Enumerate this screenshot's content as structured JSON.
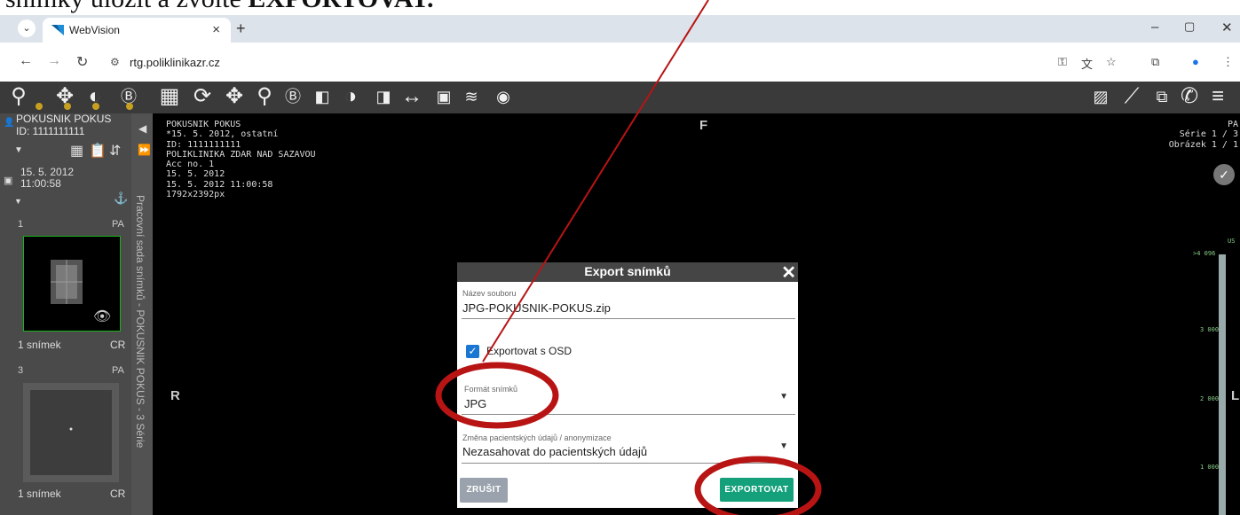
{
  "caption": {
    "pre": "snímky uložit a zvolte ",
    "bold": "EXPORTOVAT."
  },
  "browser": {
    "tab_title": "WebVision",
    "url": "rtg.poliklinikazr.cz",
    "new_tab": "+",
    "tab_close": "×",
    "win_min": "–",
    "win_max": "▢",
    "win_close": "✕",
    "tab_dropdown": "⌄"
  },
  "nav": {
    "back": "←",
    "forward": "→",
    "reload": "↻",
    "site_info": "⚙"
  },
  "patient": {
    "name": "POKUSNIK POKUS",
    "id": "ID: 1111111111",
    "study_date": "15. 5. 2012",
    "study_time": "11:00:58"
  },
  "series": [
    {
      "num": "1",
      "view": "PA",
      "count": "1 snímek",
      "modality": "CR"
    },
    {
      "num": "3",
      "view": "PA",
      "count": "1 snímek",
      "modality": "CR"
    }
  ],
  "sidebar_vertical_label": "Pracovní sada snímků - POKUSNIK POKUS - 3 Série",
  "overlay_left": "POKUSNIK POKUS\n*15. 5. 2012, ostatní\nID: 1111111111\nPOLIKLINIKA ZDAR NAD SAZAVOU\nAcc no. 1\n15. 5. 2012\n15. 5. 2012 11:00:58\n1792x2392px",
  "overlay_right": "PA\nSérie 1 / 3\nObrázek 1 / 1",
  "orientation": {
    "top": "F",
    "left": "R",
    "right": "L"
  },
  "scale_labels": [
    "US",
    ">4 096",
    "3 000",
    "2 000",
    "1 000"
  ],
  "dialog": {
    "title": "Export snímků",
    "close": "✕",
    "filename_label": "Název souboru",
    "filename_value": "JPG-POKUSNIK-POKUS.zip",
    "osd_label": "Exportovat s OSD",
    "osd_checked": true,
    "format_label": "Formát snímků",
    "format_value": "JPG",
    "anon_label": "Změna pacientských údajů / anonymizace",
    "anon_value": "Nezasahovat do pacientských údajů",
    "cancel": "ZRUŠIT",
    "export": "EXPORTOVAT"
  },
  "colors": {
    "accent": "#15a07c",
    "annotation": "#b81414",
    "checkbox": "#1976d2"
  }
}
